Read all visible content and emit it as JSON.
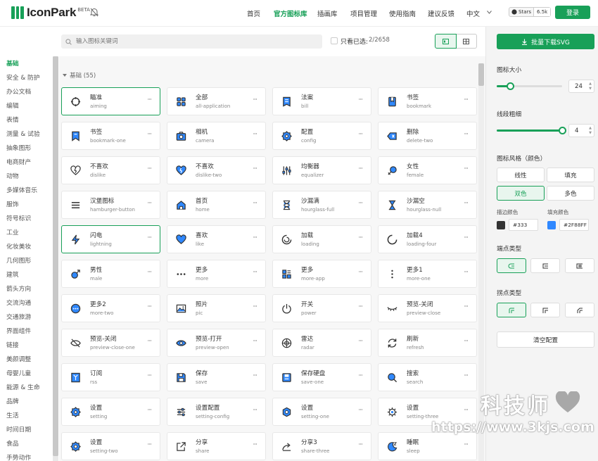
{
  "header": {
    "logo": "IconPark",
    "beta": "BETA",
    "nav": [
      "首页",
      "官方图标库",
      "插画库",
      "项目管理",
      "使用指南",
      "建议反馈"
    ],
    "active_nav": "官方图标库",
    "language": "中文",
    "github": {
      "label": "Stars",
      "count": "6.5k"
    },
    "login": "登录"
  },
  "toolbar": {
    "search_placeholder": "输入图标关键词",
    "only_selected_label": "只看已选:",
    "selected_count": "2/2658"
  },
  "sidebar": {
    "active": "基础",
    "categories": [
      "基础",
      "安全 & 防护",
      "办公文档",
      "编辑",
      "表情",
      "测量 & 试验",
      "抽象图形",
      "电商财产",
      "动物",
      "多媒体音乐",
      "服饰",
      "符号标识",
      "工业",
      "化妆美妆",
      "几何图形",
      "建筑",
      "箭头方向",
      "交流沟通",
      "交通旅游",
      "界面组件",
      "链接",
      "美颜调整",
      "母婴儿童",
      "能源 & 生命",
      "品牌",
      "生活",
      "时间日期",
      "食品",
      "手势动作"
    ]
  },
  "group": {
    "title": "基础 (55)"
  },
  "icons": [
    {
      "cn": "瞄准",
      "en": "aiming",
      "icon": "aiming-icon",
      "sel": true
    },
    {
      "cn": "全部",
      "en": "all-application",
      "icon": "all-application-icon"
    },
    {
      "cn": "法案",
      "en": "bill",
      "icon": "bill-icon"
    },
    {
      "cn": "书签",
      "en": "bookmark",
      "icon": "bookmark-icon"
    },
    {
      "cn": "书签",
      "en": "bookmark-one",
      "icon": "bookmark-one-icon"
    },
    {
      "cn": "相机",
      "en": "camera",
      "icon": "camera-icon"
    },
    {
      "cn": "配置",
      "en": "config",
      "icon": "config-icon"
    },
    {
      "cn": "删除",
      "en": "delete-two",
      "icon": "delete-two-icon"
    },
    {
      "cn": "不喜欢",
      "en": "dislike",
      "icon": "dislike-icon"
    },
    {
      "cn": "不喜欢",
      "en": "dislike-two",
      "icon": "dislike-two-icon"
    },
    {
      "cn": "均衡器",
      "en": "equalizer",
      "icon": "equalizer-icon"
    },
    {
      "cn": "女性",
      "en": "female",
      "icon": "female-icon"
    },
    {
      "cn": "汉堡图标",
      "en": "hamburger-button",
      "icon": "hamburger-button-icon"
    },
    {
      "cn": "首页",
      "en": "home",
      "icon": "home-icon"
    },
    {
      "cn": "沙漏满",
      "en": "hourglass-full",
      "icon": "hourglass-full-icon"
    },
    {
      "cn": "沙漏空",
      "en": "hourglass-null",
      "icon": "hourglass-null-icon"
    },
    {
      "cn": "闪电",
      "en": "lightning",
      "icon": "lightning-icon",
      "sel": true
    },
    {
      "cn": "喜欢",
      "en": "like",
      "icon": "like-icon"
    },
    {
      "cn": "加载",
      "en": "loading",
      "icon": "loading-icon"
    },
    {
      "cn": "加载4",
      "en": "loading-four",
      "icon": "loading-four-icon"
    },
    {
      "cn": "男性",
      "en": "male",
      "icon": "male-icon"
    },
    {
      "cn": "更多",
      "en": "more",
      "icon": "more-icon"
    },
    {
      "cn": "更多",
      "en": "more-app",
      "icon": "more-app-icon"
    },
    {
      "cn": "更多1",
      "en": "more-one",
      "icon": "more-one-icon"
    },
    {
      "cn": "更多2",
      "en": "more-two",
      "icon": "more-two-icon"
    },
    {
      "cn": "照片",
      "en": "pic",
      "icon": "pic-icon"
    },
    {
      "cn": "开关",
      "en": "power",
      "icon": "power-icon"
    },
    {
      "cn": "预览-关闭",
      "en": "preview-close",
      "icon": "preview-close-icon"
    },
    {
      "cn": "预览-关闭",
      "en": "preview-close-one",
      "icon": "preview-close-one-icon"
    },
    {
      "cn": "预览-打开",
      "en": "preview-open",
      "icon": "preview-open-icon"
    },
    {
      "cn": "雷达",
      "en": "radar",
      "icon": "radar-icon"
    },
    {
      "cn": "刷新",
      "en": "refresh",
      "icon": "refresh-icon"
    },
    {
      "cn": "订阅",
      "en": "rss",
      "icon": "rss-icon"
    },
    {
      "cn": "保存",
      "en": "save",
      "icon": "save-icon"
    },
    {
      "cn": "保存硬盘",
      "en": "save-one",
      "icon": "save-one-icon"
    },
    {
      "cn": "搜索",
      "en": "search",
      "icon": "search-icon"
    },
    {
      "cn": "设置",
      "en": "setting",
      "icon": "setting-icon"
    },
    {
      "cn": "设置配置",
      "en": "setting-config",
      "icon": "setting-config-icon"
    },
    {
      "cn": "设置",
      "en": "setting-one",
      "icon": "setting-one-icon"
    },
    {
      "cn": "设置",
      "en": "setting-three",
      "icon": "setting-three-icon"
    },
    {
      "cn": "设置",
      "en": "setting-two",
      "icon": "setting-two-icon"
    },
    {
      "cn": "分享",
      "en": "share",
      "icon": "share-icon"
    },
    {
      "cn": "分享3",
      "en": "share-three",
      "icon": "share-three-icon"
    },
    {
      "cn": "睡眠",
      "en": "sleep",
      "icon": "sleep-icon"
    }
  ],
  "panel": {
    "download": "批量下载SVG",
    "size_label": "图标大小",
    "size_value": "24",
    "size_level": 0.2,
    "stroke_label": "线段粗细",
    "stroke_value": "4",
    "stroke_level": 1.0,
    "style_label": "图标风格（颜色）",
    "styles": [
      "线性",
      "填充",
      "双色",
      "多色"
    ],
    "active_style": "双色",
    "stroke_color_label": "描边颜色",
    "stroke_color": "#333",
    "fill_color_label": "填充颜色",
    "fill_color": "#2F88FF",
    "linecap_label": "端点类型",
    "linejoin_label": "拐点类型",
    "clear": "清空配置"
  },
  "colors": {
    "brand": "#18a058",
    "stroke": "#333333",
    "fill": "#2F88FF"
  },
  "watermark": {
    "cn": "科技师",
    "url": "https://www.3kjs.com"
  }
}
